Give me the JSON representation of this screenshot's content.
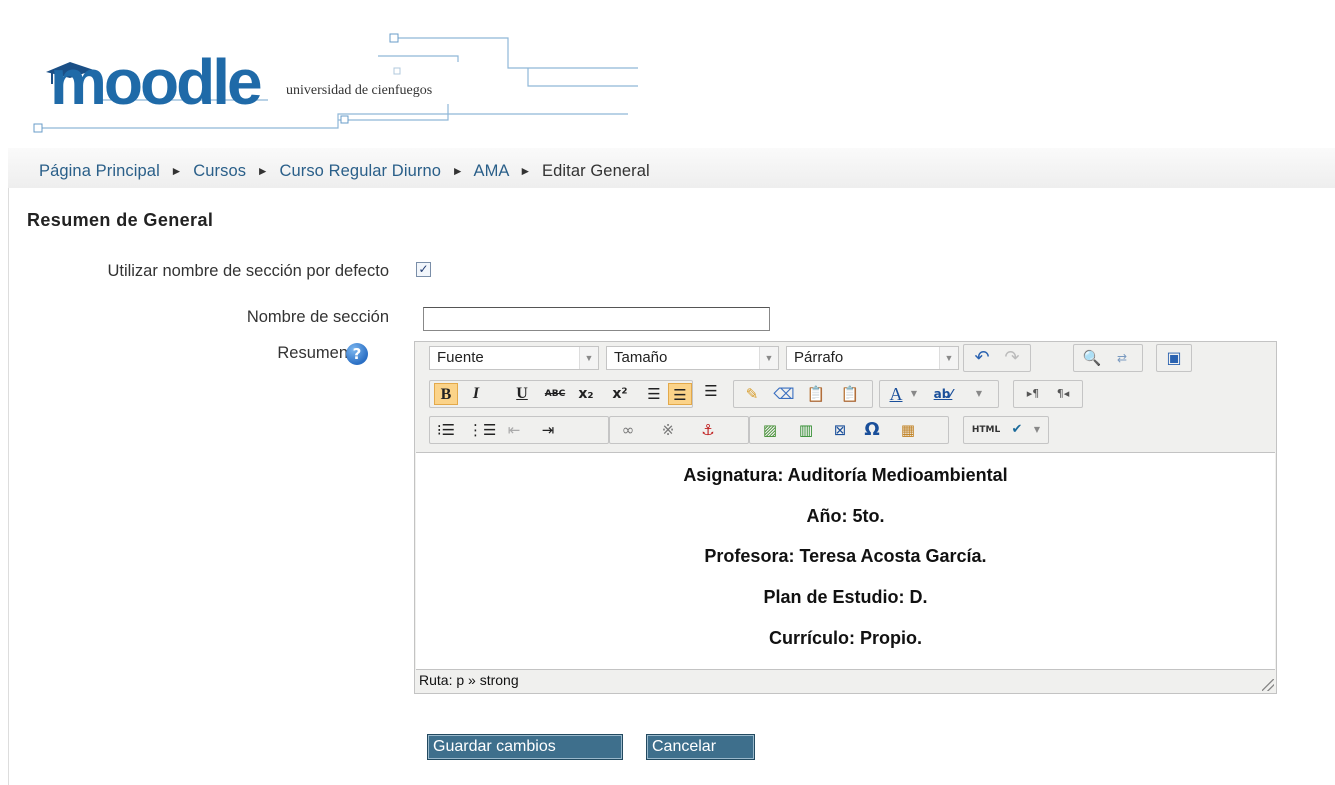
{
  "header": {
    "logo_text": "moodle",
    "logo_subtitle": "universidad de cienfuegos"
  },
  "breadcrumb": {
    "items": [
      "Página Principal",
      "Cursos",
      "Curso Regular Diurno",
      "AMA",
      "Editar General"
    ],
    "separator": "►"
  },
  "section": {
    "title": "Resumen de General"
  },
  "form": {
    "use_default_label": "Utilizar nombre de sección por defecto",
    "use_default_checked": true,
    "section_name_label": "Nombre de sección",
    "section_name_value": "",
    "summary_label": "Resumen"
  },
  "editor": {
    "toolbar": {
      "font_select": "Fuente",
      "size_select": "Tamaño",
      "format_select": "Párrafo",
      "row1_icons": [
        "undo-icon",
        "redo-icon",
        "find-icon",
        "replace-icon",
        "fullscreen-icon"
      ],
      "row2_icons": [
        "bold-icon",
        "italic-icon",
        "underline-icon",
        "strikethrough-icon",
        "subscript-icon",
        "superscript-icon",
        "align-left-icon",
        "align-center-icon",
        "align-right-icon",
        "clean-icon",
        "eraser-icon",
        "paste-text-icon",
        "paste-word-icon",
        "text-color-icon",
        "highlight-color-icon",
        "ltr-icon",
        "rtl-icon"
      ],
      "row3_icons": [
        "bullet-list-icon",
        "numbered-list-icon",
        "outdent-icon",
        "indent-icon",
        "link-icon",
        "unlink-icon",
        "anchor-icon",
        "image-icon",
        "media-icon",
        "nonbreaking-icon",
        "special-char-icon",
        "table-icon",
        "html-icon",
        "spellcheck-icon"
      ],
      "bold_label": "B",
      "italic_label": "I",
      "underline_label": "U",
      "strike_label": "ABC",
      "html_label": "HTML",
      "omega_label": "Ω",
      "active_buttons": [
        "bold",
        "align-center"
      ]
    },
    "content": [
      "Asignatura: Auditoría Medioambiental",
      "Año: 5to.",
      "Profesora: Teresa Acosta García.",
      "Plan de Estudio: D.",
      "Currículo: Propio."
    ],
    "path_label": "Ruta: p » strong"
  },
  "buttons": {
    "save": "Guardar cambios",
    "cancel": "Cancelar"
  },
  "colors": {
    "link": "#2a5f89",
    "button_bg": "#3e6f8c",
    "active_button": "#fbd389",
    "logo_blue": "#1f5f9a"
  }
}
